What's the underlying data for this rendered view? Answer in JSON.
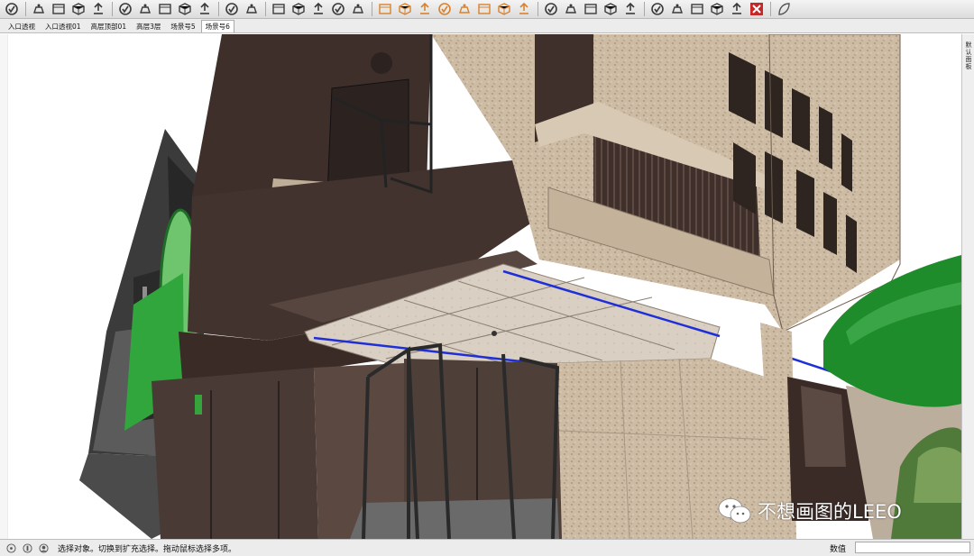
{
  "toolbar": {
    "icons": [
      "pick-icon",
      "teapot-icon",
      "teapots-icon",
      "projector-icon",
      "layers-icon",
      "window-icon",
      "window-stack-icon",
      "frame-icon",
      "lock-icon",
      "components-icon",
      "swap-icon",
      "section-icon",
      "box-icon",
      "box-wire-icon",
      "box-solid-icon",
      "sphere-icon",
      "pointer-3d-icon",
      "spot-light-icon",
      "omni-light-icon",
      "cone-light-icon",
      "directional-light-icon",
      "sun-icon",
      "dome-icon",
      "ies-light-icon",
      "render-region-icon",
      "cube-icon",
      "cube-outline-icon",
      "grass-icon",
      "fur-icon",
      "camera-icon",
      "material-icon",
      "reel-icon",
      "camera-2-icon",
      "flag-icon",
      "flag-2-icon",
      "close-red-icon",
      "leaf-icon"
    ]
  },
  "scene_tabs": [
    {
      "label": "入口透视"
    },
    {
      "label": "入口透视01"
    },
    {
      "label": "高层顶部01"
    },
    {
      "label": "高层3层"
    },
    {
      "label": "场景号5"
    },
    {
      "label": "场景号6"
    }
  ],
  "active_tab": 5,
  "right_panel": {
    "tray_label": "默认面板"
  },
  "status": {
    "text": "选择对象。切换到扩充选择。拖动鼠标选择多项。",
    "measure_label": "数值",
    "measure_value": ""
  },
  "watermark": {
    "text": "不想画图的LEEO"
  },
  "colors": {
    "accent_orange": "#d9822b",
    "selection_blue": "#1f2fd8",
    "stone": "#c9b8a2",
    "dark_panel": "#4a3a35",
    "green_glass": "#2fa33a"
  }
}
